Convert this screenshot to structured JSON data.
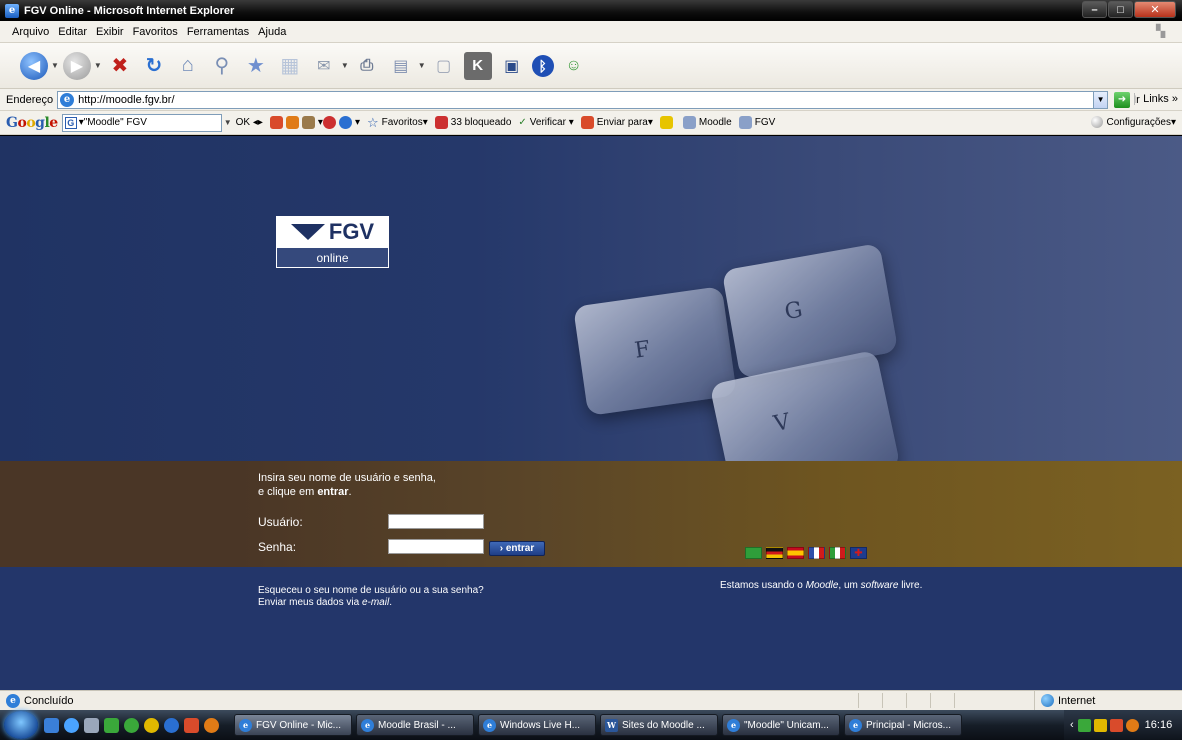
{
  "window": {
    "title": "FGV Online - Microsoft Internet Explorer",
    "controls": [
      "minimize",
      "maximize",
      "close"
    ]
  },
  "menu": [
    "Arquivo",
    "Editar",
    "Exibir",
    "Favoritos",
    "Ferramentas",
    "Ajuda"
  ],
  "toolbar": {
    "icons": [
      "back-icon",
      "forward-icon",
      "stop-icon",
      "refresh-icon",
      "home-icon",
      "search-icon",
      "favorites-icon",
      "history-icon",
      "mail-icon",
      "print-icon",
      "edit-icon",
      "discuss-icon",
      "messenger-icon",
      "research-icon",
      "bluetooth-icon",
      "contacts-icon"
    ]
  },
  "address": {
    "label": "Endereço",
    "url": "http://moodle.fgv.br/",
    "go_label": "Ir",
    "links_label": "Links"
  },
  "google": {
    "logo": "Google",
    "search_value": "\"Moodle\" FGV",
    "ok_label": "OK",
    "favoritos": "Favoritos",
    "blocked": "33 bloqueado",
    "verificar": "Verificar",
    "enviar": "Enviar para",
    "moodle": "Moodle",
    "fgv": "FGV",
    "settings": "Configurações"
  },
  "page": {
    "logo_brand": "FGV",
    "logo_sub": "online",
    "keys": [
      "F",
      "G",
      "V"
    ],
    "intro_line1": "Insira seu nome de usuário e senha,",
    "intro_line2_prefix": "e clique em ",
    "intro_line2_bold": "entrar",
    "intro_line2_suffix": ".",
    "username_label": "Usuário:",
    "password_label": "Senha:",
    "username_value": "",
    "password_value": "",
    "submit_label": "› entrar",
    "languages": [
      {
        "name": "Português",
        "color": "#2f9e3a"
      },
      {
        "name": "Deutsch",
        "color": "#d11b1b"
      },
      {
        "name": "Español",
        "color": "#e8b400"
      },
      {
        "name": "Français",
        "color": "#2f4fa8"
      },
      {
        "name": "Italiano",
        "color": "#2f9e3a"
      },
      {
        "name": "English",
        "color": "#1d3c8f"
      }
    ],
    "forgot_line1": "Esqueceu o seu nome de usuário ou a sua senha?",
    "forgot_line2_prefix": "Enviar meus dados via ",
    "forgot_line2_link": "e-mail",
    "forgot_line2_suffix": ".",
    "moodle_prefix": "Estamos usando o ",
    "moodle_link": "Moodle",
    "moodle_mid": ", um ",
    "moodle_software": "software",
    "moodle_suffix": " livre."
  },
  "status": {
    "text": "Concluído",
    "zone": "Internet"
  },
  "taskbar": {
    "tasks": [
      {
        "label": "FGV Online - Mic...",
        "icon": "ie-icon",
        "active": true
      },
      {
        "label": "Moodle Brasil - ...",
        "icon": "ie-icon",
        "active": false
      },
      {
        "label": "Windows Live H...",
        "icon": "ie-icon",
        "active": false
      },
      {
        "label": "Sites do Moodle ...",
        "icon": "word-icon",
        "active": false
      },
      {
        "label": "\"Moodle\" Unicam...",
        "icon": "ie-icon",
        "active": false
      },
      {
        "label": "Principal - Micros...",
        "icon": "ie-icon",
        "active": false
      }
    ],
    "clock": "16:16"
  }
}
